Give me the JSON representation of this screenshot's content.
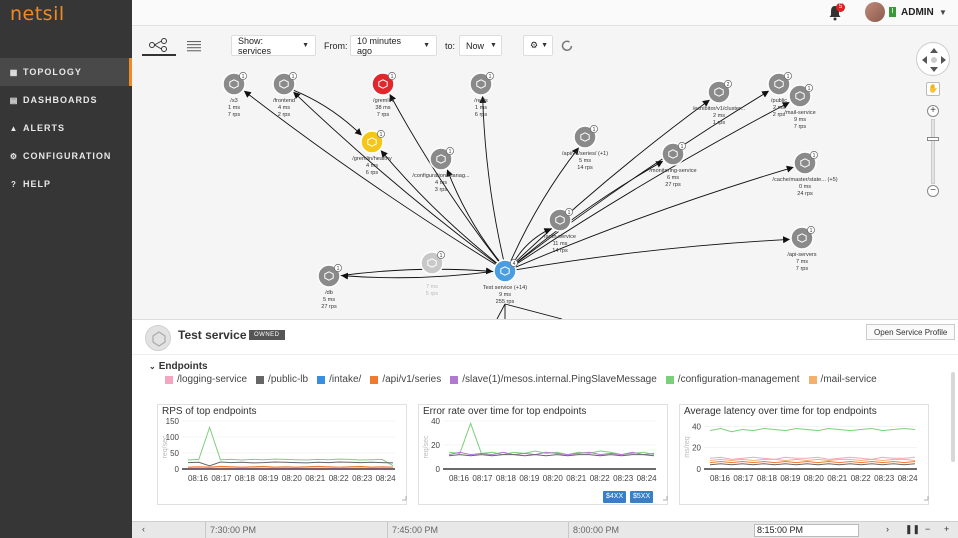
{
  "app": {
    "logo": "netsil"
  },
  "sidebar": {
    "items": [
      {
        "label": "TOPOLOGY",
        "icon": "topology-icon",
        "active": true
      },
      {
        "label": "DASHBOARDS",
        "icon": "dashboard-icon"
      },
      {
        "label": "ALERTS",
        "icon": "alert-icon"
      },
      {
        "label": "CONFIGURATION",
        "icon": "configuration-icon"
      },
      {
        "label": "HELP",
        "icon": "help-icon"
      }
    ]
  },
  "topbar": {
    "notifications": "5",
    "user_flag": "I",
    "user_name": "ADMIN"
  },
  "toolbar": {
    "show_label": "Show: services",
    "from_label": "From:",
    "from_value": "10 minutes ago",
    "to_label": "to:",
    "to_value": "Now"
  },
  "nodes": [
    {
      "id": "s3",
      "name": "/s3",
      "latency": "1 ms",
      "rps": "7 rps",
      "badge": "1",
      "color": "#8a8a8a"
    },
    {
      "id": "frontend",
      "name": "/frontend",
      "latency": "4 ms",
      "rps": "2 rps",
      "badge": "1",
      "color": "#8a8a8a"
    },
    {
      "id": "gremlin",
      "name": "/gremlin",
      "latency": "38 ms",
      "rps": "7 rps",
      "badge": "1",
      "color": "#e0272e"
    },
    {
      "id": "redis",
      "name": "/redis",
      "latency": "1 ms",
      "rps": "6 rps",
      "badge": "1",
      "color": "#8a8a8a"
    },
    {
      "id": "gremlin-healthy",
      "name": "/gremlin/healthy",
      "latency": "4 ms",
      "rps": "6 rps",
      "badge": "1",
      "color": "#f5c518"
    },
    {
      "id": "configuration-manage",
      "name": "/configuration-manag...",
      "latency": "4 ms",
      "rps": "3 rps",
      "badge": "1",
      "color": "#8a8a8a"
    },
    {
      "id": "api-v1-series",
      "name": "/api/v1/series/ (+1)",
      "latency": "5 ms",
      "rps": "14 rps",
      "badge": "1",
      "color": "#8a8a8a"
    },
    {
      "id": "exhibitor",
      "name": "/exhibitor/v1/cluster...",
      "latency": "2 ms",
      "rps": "1 rps",
      "badge": "2",
      "color": "#8a8a8a"
    },
    {
      "id": "public",
      "name": "/public",
      "latency": "2 ms",
      "rps": "2 rps",
      "badge": "1",
      "color": "#8a8a8a"
    },
    {
      "id": "mail-service",
      "name": "/mail-service",
      "latency": "9 ms",
      "rps": "7 rps",
      "badge": "1",
      "color": "#8a8a8a"
    },
    {
      "id": "monitoring-service",
      "name": "/monitoring-service",
      "latency": "6 ms",
      "rps": "27 rps",
      "badge": "1",
      "color": "#8a8a8a"
    },
    {
      "id": "cache-master",
      "name": "/cache/master/state... (+5)",
      "latency": "0 ms",
      "rps": "24 rps",
      "badge": "1",
      "color": "#8a8a8a"
    },
    {
      "id": "auth-service",
      "name": "/auth-service",
      "latency": "11 ms",
      "rps": "14 rps",
      "badge": "1",
      "color": "#8a8a8a"
    },
    {
      "id": "api-servers",
      "name": "/api-servers",
      "latency": "7 ms",
      "rps": "7 rps",
      "badge": "1",
      "color": "#8a8a8a"
    },
    {
      "id": "db",
      "name": "/db",
      "latency": "5 ms",
      "rps": "27 rps",
      "badge": "1",
      "color": "#8a8a8a"
    },
    {
      "id": "ghost",
      "name": "",
      "latency": "7 ms",
      "rps": "5 rps",
      "badge": "1",
      "color": "#c8c8c8"
    },
    {
      "id": "test-service",
      "name": "Test service (+14)",
      "latency": "9 ms",
      "rps": "255 rps",
      "badge": "4",
      "color": "#4a9de0"
    }
  ],
  "detail": {
    "service_title": "Test service",
    "owned": "OWNED",
    "open_profile": "Open Service Profile",
    "endpoints_title": "Endpoints",
    "legend": [
      {
        "label": "/logging-service",
        "color": "#f4a6c0"
      },
      {
        "label": "/public-lb",
        "color": "#666666"
      },
      {
        "label": "/intake/",
        "color": "#3a8ee0"
      },
      {
        "label": "/api/v1/series",
        "color": "#f07a30"
      },
      {
        "label": "/slave(1)/mesos.internal.PingSlaveMessage",
        "color": "#b07ad0"
      },
      {
        "label": "/configuration-management",
        "color": "#7cd07c"
      },
      {
        "label": "/mail-service",
        "color": "#f5b06e"
      }
    ]
  },
  "chart_data": [
    {
      "type": "line",
      "title": "RPS of top endpoints",
      "ylabel": "req/sec",
      "yticks": [
        "150",
        "100",
        "50",
        "0"
      ],
      "ylim": [
        0,
        150
      ],
      "categories": [
        "08:16",
        "08:17",
        "08:18",
        "08:19",
        "08:20",
        "08:21",
        "08:22",
        "08:23",
        "08:24"
      ],
      "series": [
        {
          "name": "/configuration-management",
          "color": "#7cd07c",
          "values": [
            28,
            30,
            130,
            29,
            30,
            28,
            30,
            29,
            31,
            30,
            29,
            28,
            30,
            29,
            31,
            30,
            28,
            29,
            30,
            10
          ]
        },
        {
          "name": "/public-lb",
          "color": "#666666",
          "values": [
            20,
            21,
            10,
            22,
            20,
            21,
            19,
            20,
            22,
            21,
            20,
            19,
            21,
            20,
            22,
            21,
            20,
            21,
            20,
            19
          ]
        },
        {
          "name": "/api/v1/series",
          "color": "#f07a30",
          "values": [
            6,
            7,
            6,
            8,
            7,
            6,
            7,
            8,
            6,
            7,
            6,
            7,
            8,
            7,
            6,
            7,
            8,
            6,
            7,
            6
          ]
        },
        {
          "name": "/logging-service",
          "color": "#f4a6c0",
          "values": [
            3,
            4,
            3,
            3,
            4,
            3,
            4,
            3,
            3,
            4,
            3,
            4,
            3,
            3,
            4,
            3,
            4,
            3,
            3,
            4
          ]
        }
      ]
    },
    {
      "type": "line",
      "title": "Error rate over time for top endpoints",
      "ylabel": "req/sec",
      "yticks": [
        "40",
        "20",
        "0"
      ],
      "ylim": [
        0,
        40
      ],
      "categories": [
        "08:16",
        "08:17",
        "08:18",
        "08:19",
        "08:20",
        "08:21",
        "08:22",
        "08:23",
        "08:24"
      ],
      "series": [
        {
          "name": "/configuration-management",
          "color": "#7cd07c",
          "values": [
            14,
            13,
            38,
            13,
            14,
            12,
            14,
            13,
            15,
            13,
            14,
            12,
            14,
            13,
            15,
            14,
            12,
            13,
            14,
            12
          ]
        },
        {
          "name": "/slave(1)/mesos.internal.PingSlaveMessage",
          "color": "#b07ad0",
          "values": [
            12,
            14,
            12,
            13,
            12,
            14,
            12,
            13,
            12,
            14,
            13,
            12,
            13,
            14,
            12,
            13,
            12,
            14,
            12,
            13
          ]
        },
        {
          "name": "/public-lb",
          "color": "#666666",
          "values": [
            11,
            12,
            11,
            12,
            11,
            12,
            12,
            11,
            12,
            11,
            12,
            11,
            12,
            12,
            11,
            12,
            11,
            12,
            12,
            11
          ]
        }
      ],
      "buttons": [
        "$4XX",
        "$5XX"
      ]
    },
    {
      "type": "line",
      "title": "Average latency over time for top endpoints",
      "ylabel": "ms/req",
      "yticks": [
        "40",
        "20",
        "0"
      ],
      "ylim": [
        0,
        45
      ],
      "categories": [
        "08:16",
        "08:17",
        "08:18",
        "08:19",
        "08:20",
        "08:21",
        "08:22",
        "08:23",
        "08:24"
      ],
      "series": [
        {
          "name": "/configuration-management",
          "color": "#7cd07c",
          "values": [
            36,
            38,
            35,
            37,
            36,
            38,
            37,
            36,
            38,
            37,
            36,
            38,
            37,
            36,
            37,
            38,
            36,
            37,
            38,
            37
          ]
        },
        {
          "name": "/logging-service",
          "color": "#f4a6c0",
          "values": [
            10,
            11,
            9,
            10,
            11,
            10,
            9,
            11,
            10,
            10,
            11,
            9,
            10,
            11,
            10,
            9,
            11,
            10,
            10,
            11
          ]
        },
        {
          "name": "/mail-service",
          "color": "#f5b06e",
          "values": [
            8,
            9,
            8,
            9,
            8,
            9,
            9,
            8,
            9,
            8,
            9,
            8,
            9,
            9,
            8,
            9,
            8,
            9,
            9,
            8
          ]
        },
        {
          "name": "/api/v1/series",
          "color": "#f07a30",
          "values": [
            6,
            7,
            6,
            7,
            6,
            7,
            6,
            7,
            6,
            7,
            6,
            7,
            6,
            7,
            6,
            7,
            6,
            7,
            6,
            7
          ]
        },
        {
          "name": "/public-lb",
          "color": "#666666",
          "values": [
            4,
            5,
            4,
            5,
            4,
            5,
            4,
            5,
            4,
            5,
            4,
            5,
            4,
            5,
            4,
            5,
            4,
            5,
            4,
            5
          ]
        }
      ]
    }
  ],
  "timeline": {
    "labels": [
      "7:30:00 PM",
      "7:45:00 PM",
      "8:00:00 PM"
    ],
    "current": "8:15:00 PM"
  }
}
